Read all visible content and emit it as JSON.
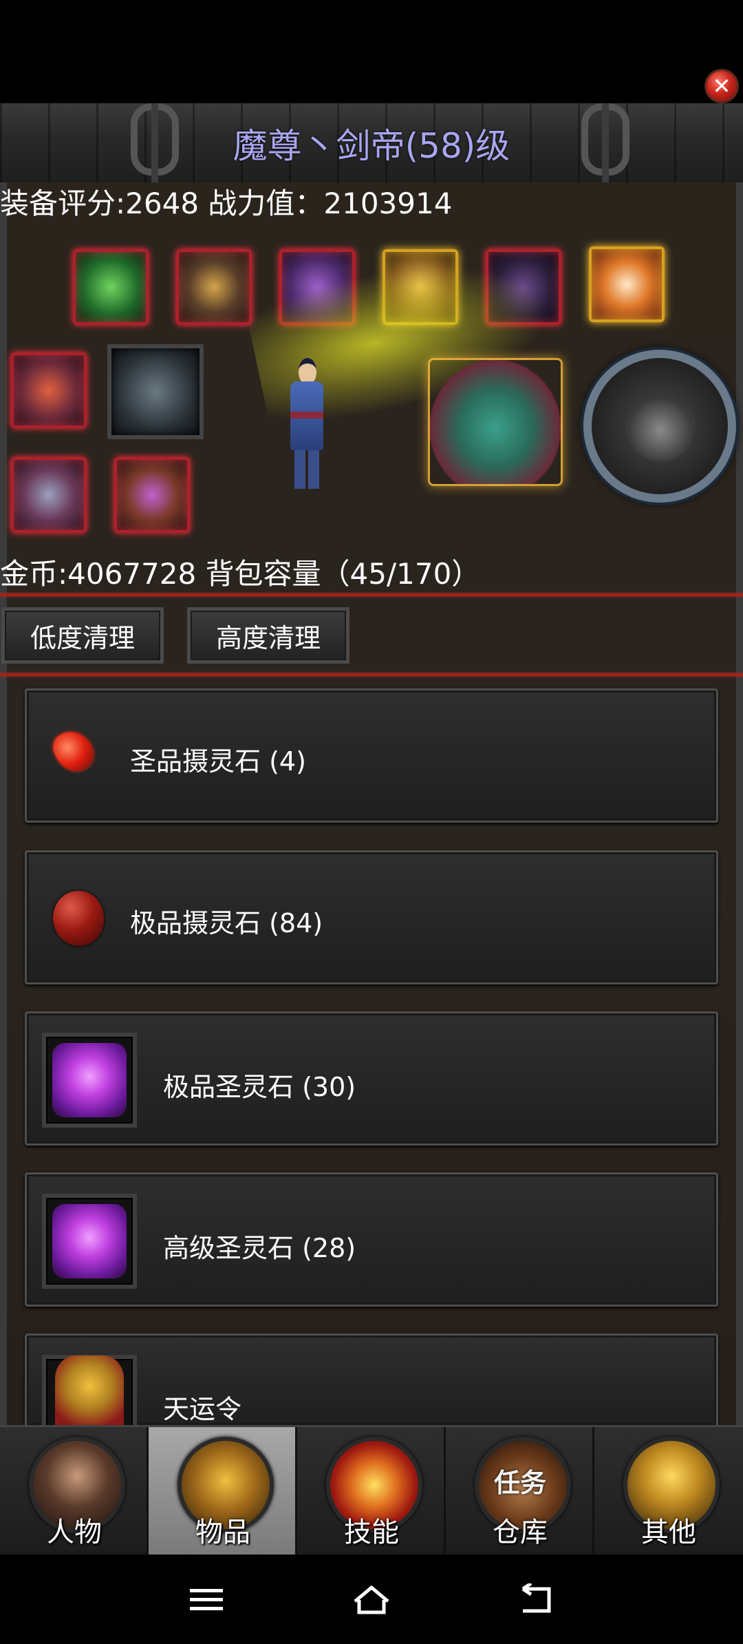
{
  "window": {
    "title": "魔尊丶剑帝(58)级",
    "close_icon": "close-icon"
  },
  "stats": {
    "score_line": "装备评分:2648 战力值：2103914"
  },
  "equipment": {
    "slots": [
      "green-armor",
      "golden-armor",
      "purple-weapon",
      "gold-bracer",
      "dark-blade",
      "rabbit-pet",
      "fire-mount",
      "steel-sword",
      "ring-silver",
      "ring-purple"
    ],
    "character": "blue-robed-swordsman",
    "pet": "green-dragon",
    "emblem": "tiger-emblem"
  },
  "inventory_info": {
    "gold_line": "金币:4067728 背包容量（45/170）"
  },
  "buttons": {
    "low_clean": "低度清理",
    "high_clean": "高度清理"
  },
  "items": [
    {
      "name": "圣品摄灵石 (4)",
      "icon": "red-gem-icon"
    },
    {
      "name": "极品摄灵石 (84)",
      "icon": "red-orb-icon"
    },
    {
      "name": "极品圣灵石 (30)",
      "icon": "purple-gem-icon"
    },
    {
      "name": "高级圣灵石 (28)",
      "icon": "purple-gem-icon"
    },
    {
      "name": "天运令",
      "icon": "token-icon"
    }
  ],
  "nav": [
    {
      "label": "人物",
      "overlay": ""
    },
    {
      "label": "物品",
      "overlay": ""
    },
    {
      "label": "技能",
      "overlay": ""
    },
    {
      "label": "仓库",
      "overlay": "任务"
    },
    {
      "label": "其他",
      "overlay": ""
    }
  ],
  "colors": {
    "title": "#a9a6f0",
    "separator": "#a0221a",
    "active_tab": "#9a9a9a"
  }
}
